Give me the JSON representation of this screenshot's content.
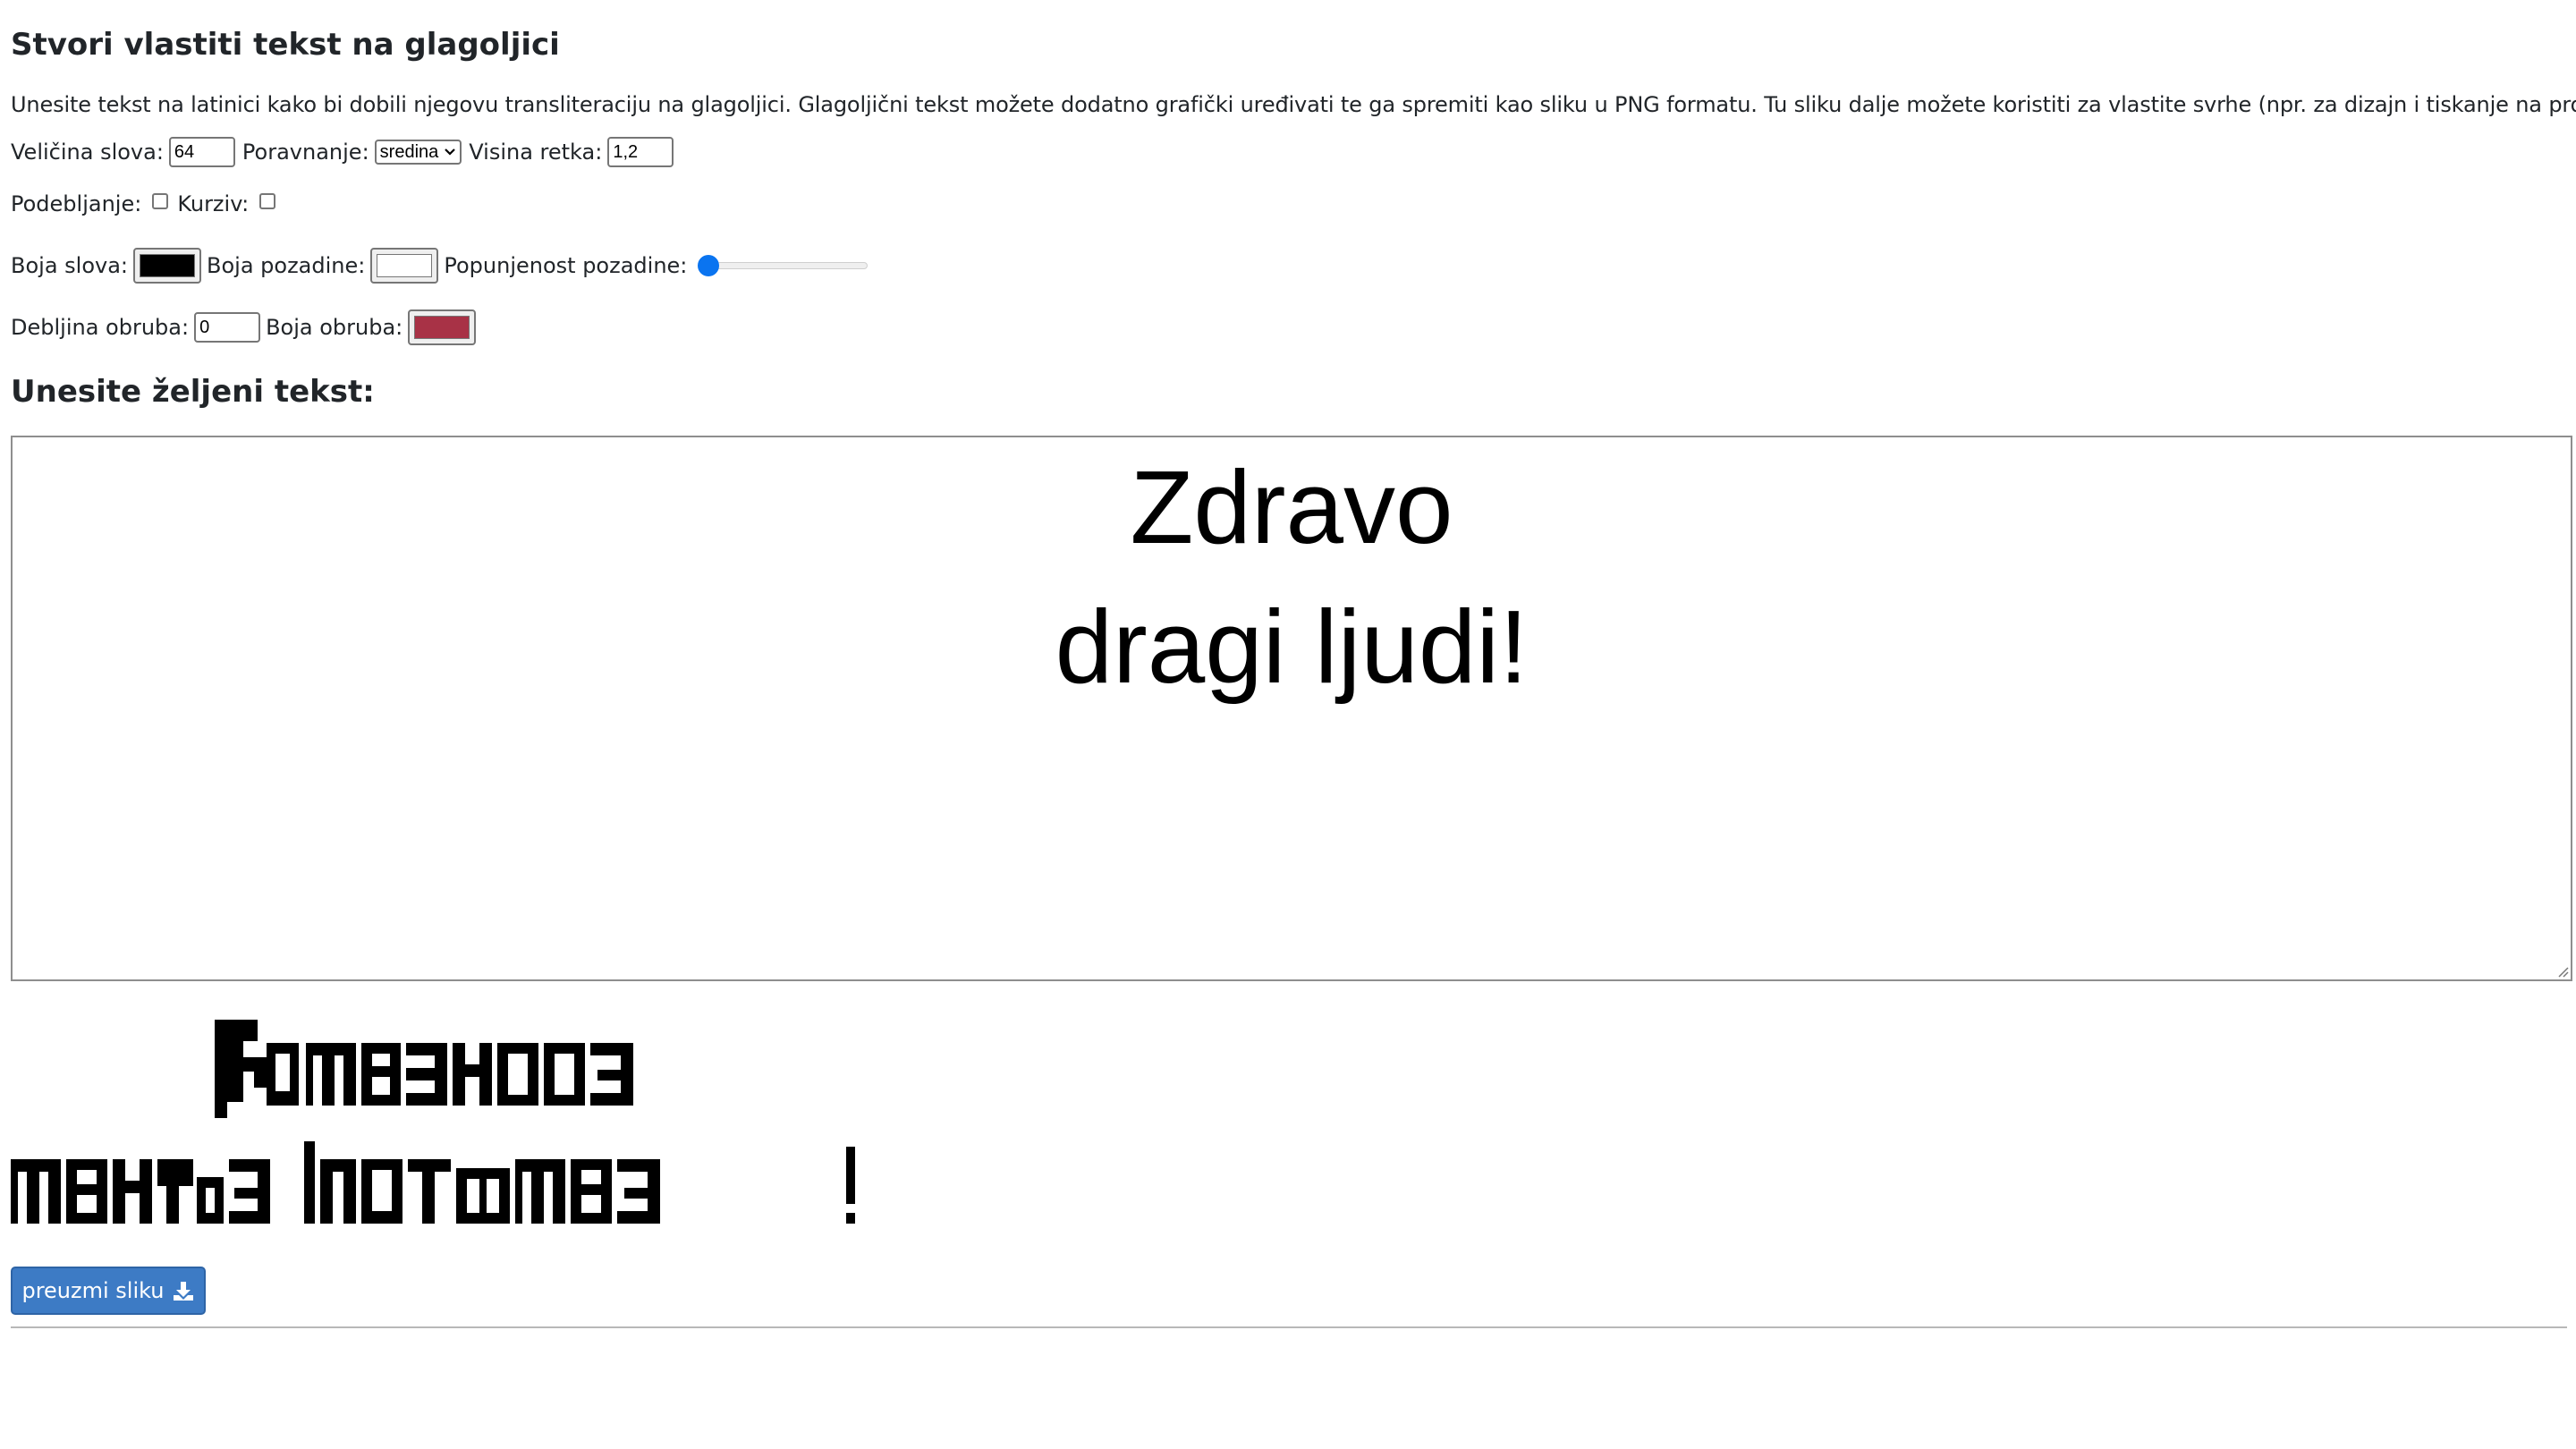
{
  "page": {
    "title": "Stvori vlastiti tekst na glagoljici",
    "intro": "Unesite tekst na latinici kako bi dobili njegovu transliteraciju na glagoljici. Glagoljični tekst možete dodatno grafički uređivati te ga spremiti kao sliku u PNG formatu. Tu sliku dalje možete koristiti za vlastite svrhe (npr. za dizajn i tiskanje na proizvode)."
  },
  "controls": {
    "font_size_label": "Veličina slova:",
    "font_size_value": "64",
    "align_label": "Poravnanje:",
    "align_value": "sredina",
    "line_height_label": "Visina retka:",
    "line_height_value": "1,2",
    "underline_label": "Podebljanje:",
    "underline_checked": false,
    "italic_label": "Kurziv:",
    "italic_checked": false,
    "text_color_label": "Boja slova:",
    "text_color": "#000000",
    "bg_color_label": "Boja pozadine:",
    "bg_color": "#ffffff",
    "bg_fill_label": "Popunjenost pozadine:",
    "bg_fill_value": 0,
    "stroke_width_label": "Debljina obruba:",
    "stroke_width_value": "0",
    "stroke_color_label": "Boja obruba:",
    "stroke_color": "#a83246"
  },
  "input": {
    "heading": "Unesite željeni tekst:",
    "lines": [
      "Zdravo",
      "dragi ljudi!"
    ]
  },
  "output": {
    "download_label": "preuzmi sliku",
    "download_icon": "download-icon"
  },
  "colors": {
    "accent": "#3d7bc5",
    "slider": "#0a74f0"
  }
}
